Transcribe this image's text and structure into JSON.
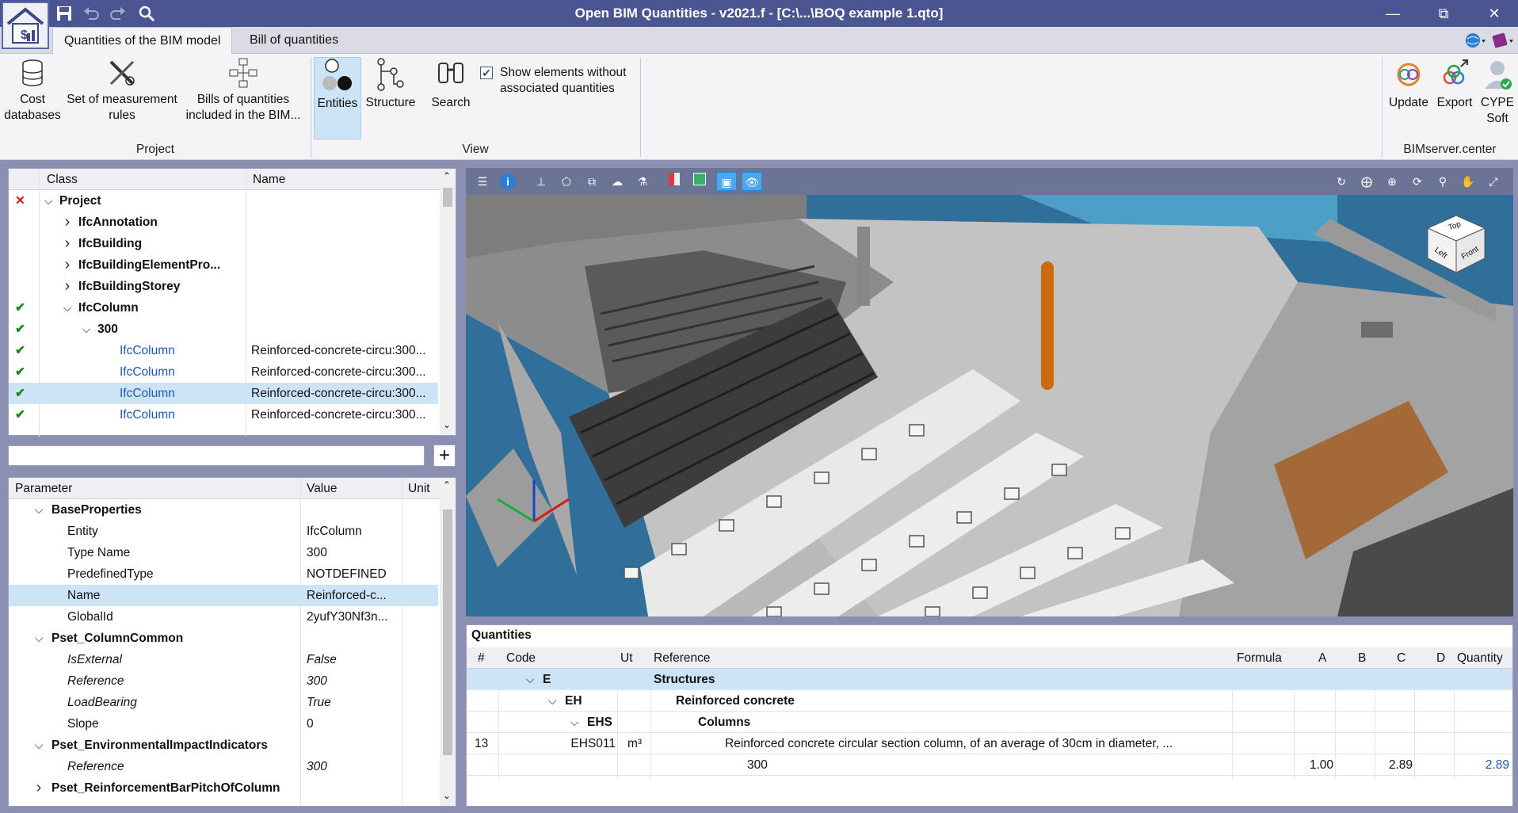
{
  "window": {
    "title": "Open BIM Quantities - v2021.f - [C:\\...\\BOQ example 1.qto]"
  },
  "tabs": [
    {
      "label": "Quantities of the BIM model"
    },
    {
      "label": "Bill of quantities"
    }
  ],
  "ribbon": {
    "project": {
      "label": "Project",
      "cost_databases": "Cost databases",
      "measurement_rules": "Set of measurement rules",
      "bills_included": "Bills of quantities included in the BIM..."
    },
    "view": {
      "label": "View",
      "entities": "Entities",
      "structure": "Structure",
      "search": "Search",
      "show_elements": "Show elements without associated quantities",
      "show_elements_checked": true
    },
    "bimserver": {
      "label": "BIMserver.center",
      "update": "Update",
      "export": "Export",
      "cype_soft": "CYPE Soft"
    }
  },
  "tree": {
    "headers": {
      "class": "Class",
      "name": "Name"
    },
    "rows": [
      {
        "status": "x",
        "indent": 0,
        "chevron": "down",
        "class": "Project",
        "name": "",
        "style": "bold"
      },
      {
        "status": "",
        "indent": 1,
        "chevron": "right",
        "class": "IfcAnnotation",
        "name": "",
        "style": "bold"
      },
      {
        "status": "",
        "indent": 1,
        "chevron": "right",
        "class": "IfcBuilding",
        "name": "",
        "style": "bold"
      },
      {
        "status": "",
        "indent": 1,
        "chevron": "right",
        "class": "IfcBuildingElementPro...",
        "name": "",
        "style": "bold"
      },
      {
        "status": "",
        "indent": 1,
        "chevron": "right",
        "class": "IfcBuildingStorey",
        "name": "",
        "style": "bold"
      },
      {
        "status": "check",
        "indent": 1,
        "chevron": "down",
        "class": "IfcColumn",
        "name": "",
        "style": "bold"
      },
      {
        "status": "check",
        "indent": 2,
        "chevron": "down",
        "class": "300",
        "name": "",
        "style": "bold"
      },
      {
        "status": "check",
        "indent": 4,
        "chevron": "",
        "class": "IfcColumn",
        "name": "Reinforced-concrete-circu:300...",
        "style": "link"
      },
      {
        "status": "check",
        "indent": 4,
        "chevron": "",
        "class": "IfcColumn",
        "name": "Reinforced-concrete-circu:300...",
        "style": "link"
      },
      {
        "status": "check",
        "indent": 4,
        "chevron": "",
        "class": "IfcColumn",
        "name": "Reinforced-concrete-circu:300...",
        "style": "link",
        "selected": true
      },
      {
        "status": "check",
        "indent": 4,
        "chevron": "",
        "class": "IfcColumn",
        "name": "Reinforced-concrete-circu:300...",
        "style": "link"
      }
    ]
  },
  "search": {
    "placeholder": ""
  },
  "properties": {
    "headers": {
      "parameter": "Parameter",
      "value": "Value",
      "unit": "Unit"
    },
    "rows": [
      {
        "indent": 1,
        "chevron": "down",
        "param": "BaseProperties",
        "value": "",
        "unit": "",
        "style": "bold"
      },
      {
        "indent": 3,
        "chevron": "",
        "param": "Entity",
        "value": "IfcColumn",
        "unit": "",
        "style": ""
      },
      {
        "indent": 3,
        "chevron": "",
        "param": "Type Name",
        "value": "300",
        "unit": "",
        "style": ""
      },
      {
        "indent": 3,
        "chevron": "",
        "param": "PredefinedType",
        "value": "NOTDEFINED",
        "unit": "",
        "style": ""
      },
      {
        "indent": 3,
        "chevron": "",
        "param": "Name",
        "value": "Reinforced-c...",
        "unit": "",
        "style": "",
        "selected": true
      },
      {
        "indent": 3,
        "chevron": "",
        "param": "GlobalId",
        "value": "2yufY30Nf3n...",
        "unit": "",
        "style": ""
      },
      {
        "indent": 1,
        "chevron": "down",
        "param": "Pset_ColumnCommon",
        "value": "",
        "unit": "",
        "style": "bold"
      },
      {
        "indent": 3,
        "chevron": "",
        "param": "IsExternal",
        "value": "False",
        "unit": "",
        "style": "ital"
      },
      {
        "indent": 3,
        "chevron": "",
        "param": "Reference",
        "value": "300",
        "unit": "",
        "style": "ital"
      },
      {
        "indent": 3,
        "chevron": "",
        "param": "LoadBearing",
        "value": "True",
        "unit": "",
        "style": "ital"
      },
      {
        "indent": 3,
        "chevron": "",
        "param": "Slope",
        "value": "0",
        "unit": "",
        "style": ""
      },
      {
        "indent": 1,
        "chevron": "down",
        "param": "Pset_EnvironmentalImpactIndicators",
        "value": "",
        "unit": "",
        "style": "bold"
      },
      {
        "indent": 3,
        "chevron": "",
        "param": "Reference",
        "value": "300",
        "unit": "",
        "style": "ital"
      },
      {
        "indent": 1,
        "chevron": "right",
        "param": "Pset_ReinforcementBarPitchOfColumn",
        "value": "",
        "unit": "",
        "style": "bold"
      }
    ]
  },
  "viewcube": {
    "top": "Top",
    "left": "Left",
    "front": "Front"
  },
  "quantities": {
    "title": "Quantities",
    "headers": {
      "num": "#",
      "code": "Code",
      "ut": "Ut",
      "reference": "Reference",
      "formula": "Formula",
      "a": "A",
      "b": "B",
      "c": "C",
      "d": "D",
      "quantity": "Quantity"
    },
    "rows": [
      {
        "num": "",
        "code": "E",
        "code_indent": 1,
        "chev": "down",
        "ut": "",
        "reference": "Structures",
        "ref_indent": 0,
        "formula": "",
        "a": "",
        "b": "",
        "c": "",
        "d": "",
        "quantity": "",
        "bold": true,
        "selected": true
      },
      {
        "num": "",
        "code": "EH",
        "code_indent": 2,
        "chev": "down",
        "ut": "",
        "reference": "Reinforced concrete",
        "ref_indent": 1,
        "formula": "",
        "a": "",
        "b": "",
        "c": "",
        "d": "",
        "quantity": "",
        "bold": true
      },
      {
        "num": "",
        "code": "EHS",
        "code_indent": 3,
        "chev": "down",
        "ut": "",
        "reference": "Columns",
        "ref_indent": 2,
        "formula": "",
        "a": "",
        "b": "",
        "c": "",
        "d": "",
        "quantity": "",
        "bold": true
      },
      {
        "num": "13",
        "code": "EHS011",
        "code_indent": 0,
        "chev": "",
        "ut": "m³",
        "reference": "Reinforced concrete circular section column, of an average of 30cm in diameter, ...",
        "ref_indent": 3,
        "formula": "",
        "a": "",
        "b": "",
        "c": "",
        "d": "",
        "quantity": "",
        "bold": false,
        "right_code": true
      },
      {
        "num": "",
        "code": "",
        "code_indent": 0,
        "chev": "",
        "ut": "",
        "reference": "300",
        "ref_indent": 4,
        "formula": "",
        "a": "1.00",
        "b": "",
        "c": "2.89",
        "d": "",
        "quantity": "2.89",
        "bold": false
      }
    ]
  }
}
